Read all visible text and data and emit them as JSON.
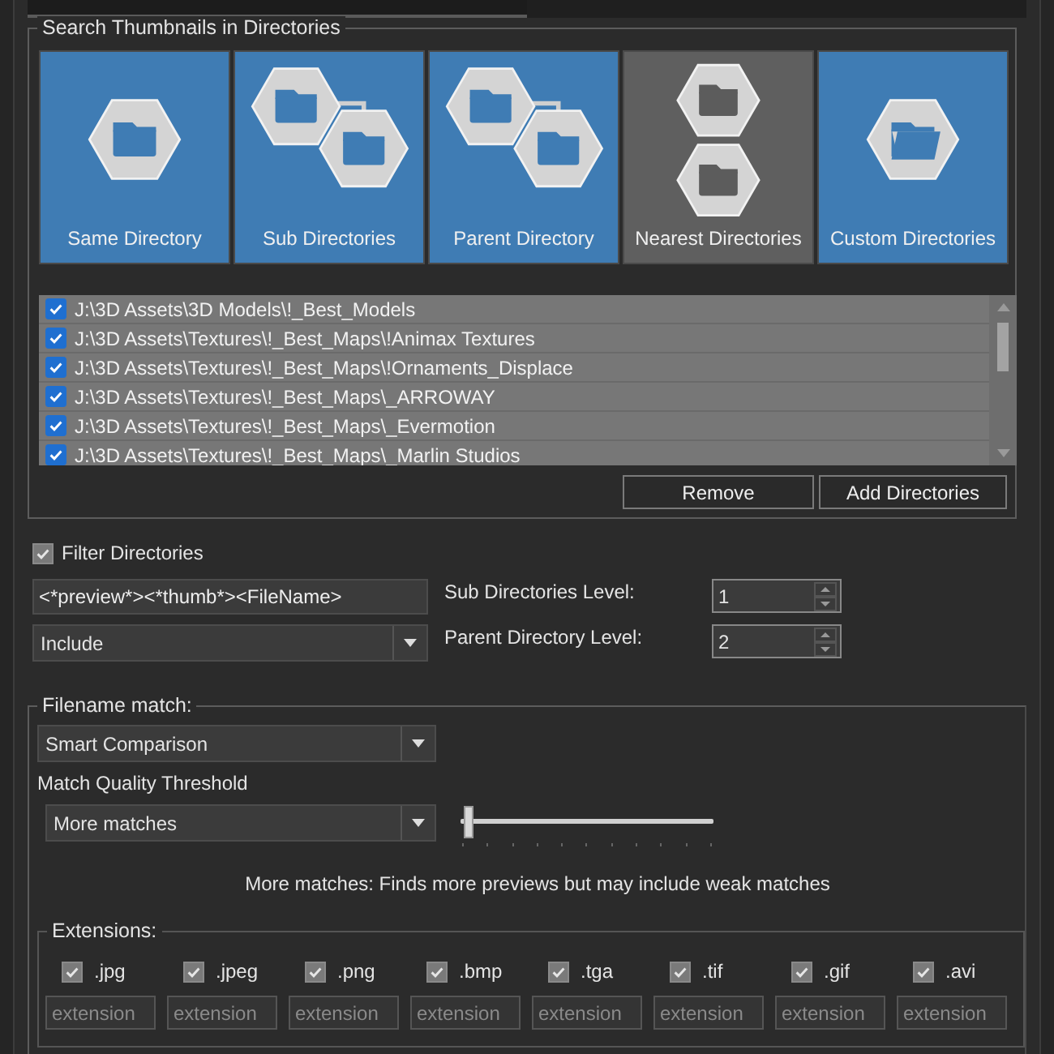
{
  "tabs": [
    {
      "selected": true
    },
    {
      "selected": false
    }
  ],
  "search_group": {
    "title": "Search Thumbnails in Directories",
    "modes": [
      {
        "label": "Same Directory",
        "kind": "same",
        "selected": false
      },
      {
        "label": "Sub Directories",
        "kind": "sub",
        "selected": false
      },
      {
        "label": "Parent Directory",
        "kind": "parent",
        "selected": false
      },
      {
        "label": "Nearest Directories",
        "kind": "nearest",
        "selected": true
      },
      {
        "label": "Custom Directories",
        "kind": "custom",
        "selected": false
      }
    ],
    "directories": [
      {
        "path": "J:\\3D Assets\\3D Models\\!_Best_Models",
        "checked": true
      },
      {
        "path": "J:\\3D Assets\\Textures\\!_Best_Maps\\!Animax Textures",
        "checked": true
      },
      {
        "path": "J:\\3D Assets\\Textures\\!_Best_Maps\\!Ornaments_Displace",
        "checked": true
      },
      {
        "path": "J:\\3D Assets\\Textures\\!_Best_Maps\\_ARROWAY",
        "checked": true
      },
      {
        "path": "J:\\3D Assets\\Textures\\!_Best_Maps\\_Evermotion",
        "checked": true
      },
      {
        "path": "J:\\3D Assets\\Textures\\!_Best_Maps\\_Marlin Studios",
        "checked": true
      }
    ],
    "buttons": [
      "Remove",
      "Add Directories"
    ]
  },
  "filter": {
    "label": "Filter Directories",
    "checked": true,
    "pattern": "<*preview*><*thumb*><FileName>",
    "mode": "Include"
  },
  "levels": [
    {
      "label": "Sub Directories Level:",
      "value": "1"
    },
    {
      "label": "Parent Directory Level:",
      "value": "2"
    }
  ],
  "filename_match": {
    "title": "Filename match:",
    "method": "Smart Comparison",
    "threshold_label": "Match Quality Threshold",
    "threshold": "More matches",
    "slider": {
      "level": 0.03
    },
    "description": "More matches: Finds more previews but may include weak matches"
  },
  "extensions": {
    "title": "Extensions:",
    "items": [
      {
        "label": ".jpg",
        "checked": true
      },
      {
        "label": ".jpeg",
        "checked": true
      },
      {
        "label": ".png",
        "checked": true
      },
      {
        "label": ".bmp",
        "checked": true
      },
      {
        "label": ".tga",
        "checked": true
      },
      {
        "label": ".tif",
        "checked": true
      },
      {
        "label": ".gif",
        "checked": true
      },
      {
        "label": ".avi",
        "checked": true
      }
    ],
    "fields": [
      {
        "placeholder": "extension"
      },
      {
        "placeholder": "extension"
      },
      {
        "placeholder": "extension"
      },
      {
        "placeholder": "extension"
      },
      {
        "placeholder": "extension"
      },
      {
        "placeholder": "extension"
      },
      {
        "placeholder": "extension"
      },
      {
        "placeholder": "extension"
      }
    ]
  }
}
